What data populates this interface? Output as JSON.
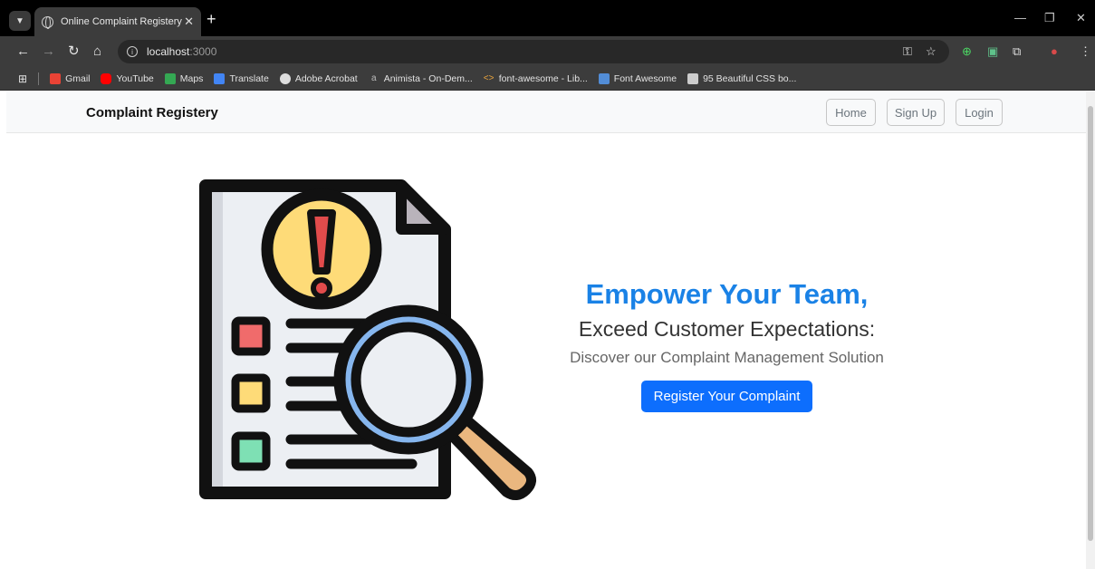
{
  "browser": {
    "tab_title": "Online Complaint Registery",
    "url_host": "localhost",
    "url_port": ":3000",
    "bookmarks": [
      {
        "label": "Gmail",
        "icon": "gmail-icon",
        "color": "#ea4335"
      },
      {
        "label": "YouTube",
        "icon": "youtube-icon",
        "color": "#ff0000"
      },
      {
        "label": "Maps",
        "icon": "maps-icon",
        "color": "#34a853"
      },
      {
        "label": "Translate",
        "icon": "translate-icon",
        "color": "#4285f4"
      },
      {
        "label": "Adobe Acrobat",
        "icon": "globe-icon",
        "color": "#dddddd"
      },
      {
        "label": "Animista - On-Dem...",
        "icon": "animista-icon",
        "color": "#bbbbbb"
      },
      {
        "label": "font-awesome - Lib...",
        "icon": "code-icon",
        "color": "#e8a33d"
      },
      {
        "label": "Font Awesome",
        "icon": "flag-icon",
        "color": "#528dd7"
      },
      {
        "label": "95 Beautiful CSS bo...",
        "icon": "page-icon",
        "color": "#cccccc"
      }
    ]
  },
  "navbar": {
    "brand": "Complaint Registery",
    "links": [
      "Home",
      "Sign Up",
      "Login"
    ]
  },
  "hero": {
    "headline": "Empower Your Team,",
    "subheadline": "Exceed Customer Expectations:",
    "tagline": "Discover our Complaint Management Solution",
    "cta_label": "Register Your Complaint"
  },
  "colors": {
    "accent": "#0d6efd",
    "headline": "#1a82e6",
    "alert_yellow": "#fedb78",
    "box_red": "#f06b6b",
    "box_yellow": "#fedb78",
    "box_green": "#7ee0b4",
    "lens_blue": "#86b6ee",
    "handle_tan": "#eab77f"
  }
}
